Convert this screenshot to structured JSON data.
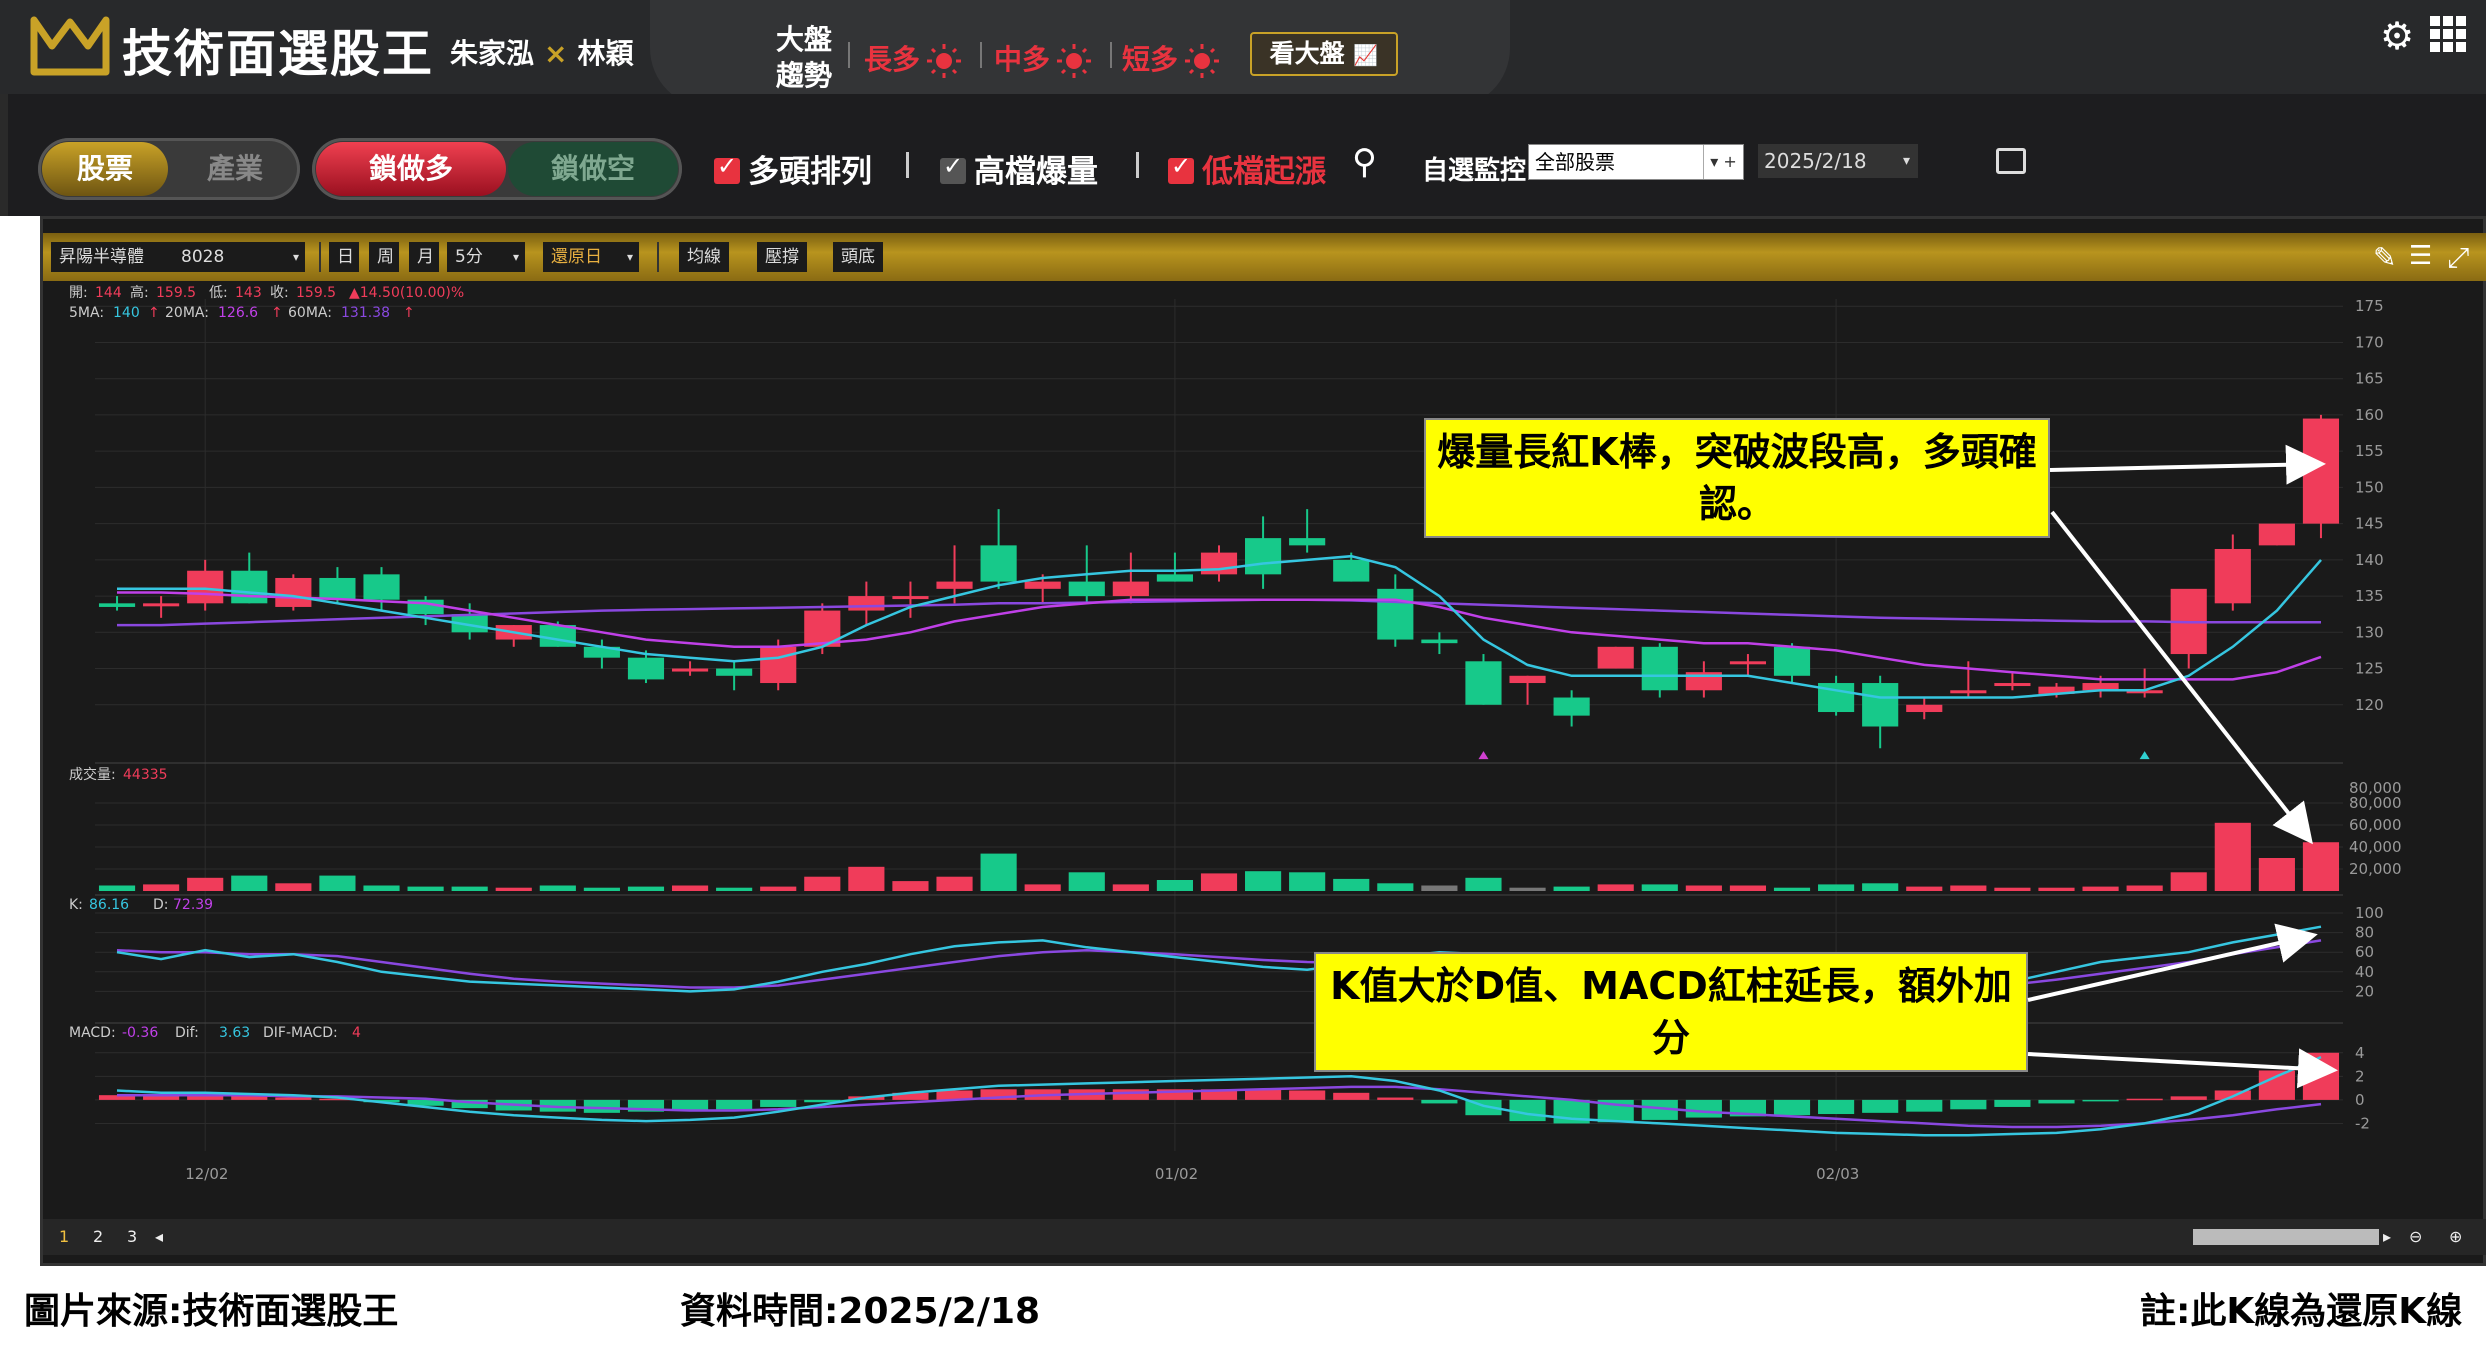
{
  "app": {
    "title": "技術面選股王",
    "host1": "朱家泓",
    "host2": "林穎",
    "x_mark": "×"
  },
  "market": {
    "label_line1": "大盤",
    "label_line2": "趨勢",
    "trends": [
      {
        "label": "長多",
        "color": "#e8333f"
      },
      {
        "label": "中多",
        "color": "#e8333f"
      },
      {
        "label": "短多",
        "color": "#e8333f"
      }
    ],
    "view_button": "看大盤"
  },
  "toolbar": {
    "seg1": {
      "on": "股票",
      "off": "產業"
    },
    "seg2": {
      "on": "鎖做多",
      "off": "鎖做空"
    },
    "filters": [
      {
        "label": "多頭排列",
        "checked": true,
        "accent": "#e8333f",
        "text_color": "#ffffff"
      },
      {
        "label": "高檔爆量",
        "checked": true,
        "accent": "#555555",
        "text_color": "#ffffff"
      },
      {
        "label": "低檔起漲",
        "checked": true,
        "accent": "#e8333f",
        "text_color": "#e8333f"
      }
    ],
    "monitor_label": "自選監控",
    "monitor_value": "全部股票",
    "date_value": "2025/2/18"
  },
  "chart_toolbar": {
    "stock_name": "昇陽半導體",
    "stock_code": "8028",
    "day": "日",
    "week": "周",
    "month": "月",
    "interval": "5分",
    "restore": "還原日",
    "btn_ma": "均線",
    "btn_pressure": "壓撐",
    "btn_head": "頭底"
  },
  "chart_data": {
    "type": "candlestick",
    "ohlc_header": {
      "open_label": "開:",
      "open": "144",
      "high_label": "高:",
      "high": "159.5",
      "low_label": "低:",
      "low": "143",
      "close_label": "收:",
      "close": "159.5",
      "change": "▲14.50(10.00)%"
    },
    "ma_header": {
      "ma5_label": "5MA:",
      "ma5": "140",
      "ma20_label": "20MA:",
      "ma20": "126.6",
      "ma60_label": "60MA:",
      "ma60": "131.38",
      "arrow": "↑"
    },
    "price_axis": {
      "ticks": [
        120,
        125,
        130,
        135,
        140,
        145,
        150,
        155,
        160,
        165,
        170,
        175
      ],
      "range": [
        115,
        176
      ]
    },
    "x_labels": [
      {
        "idx": 2,
        "text": "12/02"
      },
      {
        "idx": 24,
        "text": "01/02"
      },
      {
        "idx": 39,
        "text": "02/03"
      }
    ],
    "candles": [
      [
        134,
        135,
        133,
        133.5
      ],
      [
        134,
        135,
        132,
        134
      ],
      [
        134,
        140,
        133,
        138.5
      ],
      [
        138.5,
        141,
        134,
        134
      ],
      [
        133.5,
        138,
        133,
        137.5
      ],
      [
        137.5,
        139,
        134,
        134.5
      ],
      [
        138,
        139,
        133,
        134.5
      ],
      [
        134.5,
        135,
        131,
        132.5
      ],
      [
        132.5,
        134,
        129,
        130
      ],
      [
        129,
        131,
        128,
        131
      ],
      [
        131,
        131.5,
        128,
        128
      ],
      [
        128,
        129,
        125,
        126.5
      ],
      [
        126.5,
        127.5,
        123,
        123.5
      ],
      [
        125,
        126,
        124,
        125
      ],
      [
        125,
        126,
        122,
        124
      ],
      [
        123,
        129,
        122,
        128
      ],
      [
        128,
        134,
        127,
        133
      ],
      [
        133,
        137,
        131,
        135
      ],
      [
        135,
        137,
        132,
        135
      ],
      [
        136,
        142,
        134,
        137
      ],
      [
        142,
        147,
        136,
        137
      ],
      [
        136,
        138,
        134,
        137
      ],
      [
        137,
        142,
        134,
        135
      ],
      [
        135,
        141,
        134,
        137
      ],
      [
        138,
        141,
        137,
        137
      ],
      [
        138,
        142,
        137,
        141
      ],
      [
        143,
        146,
        136,
        138
      ],
      [
        143,
        147,
        141,
        142
      ],
      [
        140,
        141,
        137,
        137
      ],
      [
        136,
        138,
        128,
        129
      ],
      [
        129,
        130,
        127,
        128.5
      ],
      [
        126,
        127,
        120,
        120
      ],
      [
        123,
        124,
        120,
        124
      ],
      [
        121,
        122,
        117,
        118.5
      ],
      [
        125,
        128,
        125,
        128
      ],
      [
        128,
        128.5,
        121,
        122
      ],
      [
        122,
        126,
        121,
        124.5
      ],
      [
        126,
        127,
        124,
        126
      ],
      [
        128,
        128.5,
        123,
        124
      ],
      [
        123,
        124,
        118.5,
        119
      ],
      [
        123,
        124,
        114,
        117
      ],
      [
        119,
        121,
        118,
        120
      ],
      [
        122,
        126,
        121,
        122
      ],
      [
        123,
        124.5,
        122,
        123
      ],
      [
        121.5,
        123,
        121,
        122.5
      ],
      [
        122,
        124,
        121,
        123
      ],
      [
        122,
        125,
        121,
        122
      ],
      [
        127,
        134,
        125,
        136
      ],
      [
        134,
        143.5,
        133,
        141.5
      ],
      [
        142,
        144,
        142,
        145
      ],
      [
        145,
        160,
        143,
        159.5
      ]
    ],
    "ma5": [
      136,
      136,
      136,
      135.5,
      135,
      134,
      133,
      132,
      131,
      130,
      129,
      128,
      127,
      126.5,
      126,
      126.5,
      128,
      131,
      133.5,
      135,
      136.5,
      137.5,
      138,
      138.5,
      138.5,
      138.7,
      139.5,
      140,
      140.5,
      139,
      135,
      129,
      125.5,
      124,
      124,
      124,
      124,
      124,
      123,
      122,
      121,
      121,
      121,
      121,
      121.5,
      122,
      122,
      124,
      128,
      133,
      140
    ],
    "ma20": [
      135.5,
      135.5,
      135.3,
      135,
      134.8,
      134.6,
      134.3,
      134,
      133,
      132,
      131,
      130,
      129,
      128.5,
      128,
      128,
      128.5,
      129,
      130,
      131.5,
      132.5,
      133.5,
      134,
      134.5,
      134.5,
      134.5,
      134.5,
      134.5,
      134.5,
      134.5,
      133.5,
      132,
      131,
      130,
      129.5,
      129,
      128.5,
      128.5,
      128,
      127.5,
      126.5,
      125.5,
      125,
      124.5,
      124,
      123.5,
      123.5,
      123.5,
      123.5,
      124.5,
      126.6
    ],
    "ma60": [
      131,
      131,
      131.2,
      131.4,
      131.6,
      131.8,
      132,
      132.2,
      132.4,
      132.6,
      132.8,
      133,
      133.1,
      133.2,
      133.3,
      133.4,
      133.5,
      133.6,
      133.7,
      133.8,
      134,
      134,
      134.1,
      134.2,
      134.3,
      134.4,
      134.5,
      134.5,
      134.4,
      134.2,
      134,
      133.8,
      133.6,
      133.4,
      133.2,
      133,
      132.8,
      132.6,
      132.4,
      132.2,
      132,
      131.9,
      131.8,
      131.7,
      131.6,
      131.5,
      131.5,
      131.4,
      131.4,
      131.38,
      131.38
    ],
    "volume": {
      "label": "成交量:",
      "value": "44335",
      "axis_ticks": [
        20000,
        40000,
        60000,
        80000
      ],
      "axis_max_label": "80,000",
      "max": 100000
    },
    "volumes": [
      5000,
      6000,
      12000,
      14000,
      7000,
      14000,
      5000,
      4000,
      4000,
      3000,
      5000,
      3000,
      4000,
      5000,
      3000,
      4000,
      13000,
      22000,
      9000,
      13000,
      34000,
      6000,
      17000,
      6000,
      10000,
      16000,
      18000,
      17000,
      11000,
      7000,
      5000,
      12000,
      3000,
      4000,
      6000,
      6000,
      5000,
      5000,
      3000,
      6000,
      7000,
      4000,
      5000,
      3000,
      3000,
      4000,
      5000,
      17000,
      62000,
      30000,
      44335
    ],
    "kd": {
      "k_label": "K:",
      "k": "86.16",
      "d_label": "D:",
      "d": "72.39",
      "axis_ticks": [
        20,
        40,
        60,
        80,
        100
      ]
    },
    "k_series": [
      60,
      53,
      62,
      55,
      58,
      50,
      40,
      35,
      30,
      28,
      26,
      24,
      22,
      20,
      22,
      30,
      40,
      48,
      58,
      66,
      70,
      72,
      65,
      60,
      55,
      50,
      45,
      42,
      48,
      55,
      60,
      58,
      55,
      52,
      48,
      40,
      35,
      30,
      25,
      20,
      20,
      22,
      25,
      30,
      40,
      50,
      55,
      60,
      70,
      78,
      86
    ],
    "d_series": [
      62,
      60,
      60,
      58,
      58,
      56,
      50,
      44,
      38,
      33,
      30,
      28,
      26,
      24,
      24,
      26,
      32,
      38,
      44,
      50,
      56,
      60,
      62,
      60,
      58,
      55,
      52,
      50,
      49,
      51,
      54,
      55,
      55,
      54,
      52,
      48,
      44,
      40,
      35,
      30,
      27,
      25,
      25,
      27,
      32,
      38,
      44,
      50,
      58,
      65,
      72
    ],
    "macd": {
      "macd_label": "MACD:",
      "macd": "-0.36",
      "dif_label": "Dif:",
      "dif": "3.63",
      "osc_label": "DIF-MACD:",
      "osc": "4",
      "axis_ticks": [
        -2,
        0,
        2,
        4
      ]
    },
    "osc_series": [
      0.4,
      0.3,
      0.4,
      0.3,
      0.2,
      0.1,
      -0.2,
      -0.5,
      -0.7,
      -0.9,
      -1.0,
      -1.1,
      -1.0,
      -0.9,
      -0.8,
      -0.6,
      -0.2,
      0.3,
      0.6,
      0.8,
      0.9,
      0.9,
      0.9,
      0.9,
      0.9,
      0.9,
      0.9,
      0.8,
      0.6,
      0.2,
      -0.3,
      -1.3,
      -1.8,
      -2.0,
      -1.9,
      -1.7,
      -1.5,
      -1.4,
      -1.3,
      -1.2,
      -1.1,
      -1.0,
      -0.8,
      -0.6,
      -0.3,
      -0.1,
      0.1,
      0.3,
      0.8,
      2.5,
      4.0
    ],
    "dif_series": [
      0.8,
      0.6,
      0.6,
      0.5,
      0.4,
      0.2,
      -0.2,
      -0.6,
      -1.0,
      -1.3,
      -1.5,
      -1.7,
      -1.8,
      -1.7,
      -1.5,
      -1.0,
      -0.4,
      0.2,
      0.6,
      0.9,
      1.2,
      1.3,
      1.4,
      1.5,
      1.6,
      1.7,
      1.8,
      1.9,
      2.0,
      1.6,
      0.8,
      -0.5,
      -1.2,
      -1.6,
      -1.8,
      -2.0,
      -2.2,
      -2.4,
      -2.6,
      -2.8,
      -2.9,
      -3.0,
      -3.0,
      -2.9,
      -2.8,
      -2.5,
      -2.0,
      -1.2,
      0.3,
      2.0,
      3.63
    ],
    "macd_series": [
      0.4,
      0.4,
      0.4,
      0.4,
      0.3,
      0.3,
      0.2,
      0.1,
      -0.2,
      -0.4,
      -0.6,
      -0.7,
      -0.8,
      -0.9,
      -0.9,
      -0.8,
      -0.6,
      -0.4,
      -0.2,
      0.0,
      0.2,
      0.4,
      0.5,
      0.6,
      0.7,
      0.8,
      0.9,
      1.0,
      1.1,
      1.1,
      0.9,
      0.6,
      0.3,
      0.0,
      -0.4,
      -0.7,
      -1.0,
      -1.2,
      -1.4,
      -1.6,
      -1.8,
      -2.0,
      -2.2,
      -2.3,
      -2.3,
      -2.2,
      -2.0,
      -1.7,
      -1.3,
      -0.8,
      -0.36
    ]
  },
  "annotations": {
    "a1": "爆量長紅K棒，突破波段高，多頭確認。",
    "a2": "K值大於D值、MACD紅柱延長，額外加分"
  },
  "pager": {
    "p1": "1",
    "p2": "2",
    "p3": "3"
  },
  "caption": {
    "source": "圖片來源:技術面選股王",
    "date": "資料時間:2025/2/18",
    "note": "註:此K線為還原K線"
  },
  "colors": {
    "up": "#f03c5a",
    "down": "#17c98a",
    "ma5": "#36c6e0",
    "ma20": "#c040e8",
    "ma60": "#8a48e0",
    "gold": "#c9a227"
  }
}
